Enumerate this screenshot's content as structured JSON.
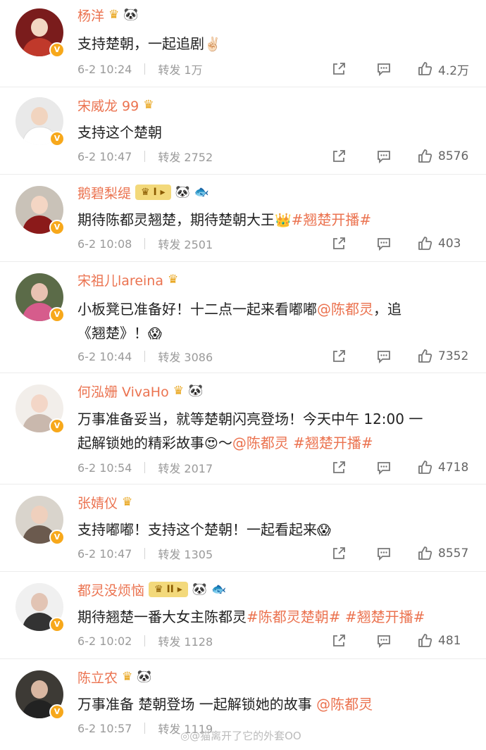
{
  "comments": [
    {
      "name": "杨洋",
      "badges": [
        "crown-icon",
        "panda-icon"
      ],
      "text": "支持楚朝，一起追剧",
      "emoji": "✌🏻",
      "date": "6-2 10:24",
      "repost": "转发 1万",
      "likes": "4.2万",
      "avatar_colors": [
        "#7a1c1c",
        "#f2d7c2",
        "#c0392b"
      ]
    },
    {
      "name": "宋威龙 99",
      "badges": [
        "crown-icon"
      ],
      "text": "支持这个楚朝",
      "date": "6-2 10:47",
      "repost": "转发 2752",
      "likes": "8576",
      "avatar_colors": [
        "#e9e9e9",
        "#f1d4bf",
        "#ffffff"
      ]
    },
    {
      "name": "鹅碧梨缇",
      "badges": [
        "crown-level-icon",
        "panda-icon",
        "fish-icon"
      ],
      "level": "I",
      "text": "期待陈都灵翘楚，期待楚朝大王",
      "emoji": "👑",
      "tag": "#翘楚开播#",
      "date": "6-2 10:08",
      "repost": "转发 2501",
      "likes": "403",
      "avatar_colors": [
        "#c9c2b8",
        "#f4d6c4",
        "#8b1a1a"
      ]
    },
    {
      "name": "宋祖儿lareina",
      "badges": [
        "crown-icon"
      ],
      "text_a": "小板凳已准备好！十二点一起来看嘟嘟",
      "mention": "@陈都灵",
      "text_b": "，追",
      "text_c": "《翘楚》！",
      "emoji": "😱",
      "date": "6-2 10:44",
      "repost": "转发 3086",
      "likes": "7352",
      "avatar_colors": [
        "#5b6b48",
        "#e8c2b2",
        "#d65c8c"
      ]
    },
    {
      "name": "何泓姗 VivaHo",
      "badges": [
        "crown-icon",
        "panda-icon"
      ],
      "text_a": "万事准备妥当，就等楚朝闪亮登场！今天中午 12:00 一",
      "text_b": "起解锁她的精彩故事",
      "emoji": "😍",
      "text_c": "～",
      "mention": "@陈都灵",
      "tag": "#翘楚开播#",
      "date": "6-2 10:54",
      "repost": "转发 2017",
      "likes": "4718",
      "avatar_colors": [
        "#f2eeea",
        "#f3d6c7",
        "#c9b8ad"
      ]
    },
    {
      "name": "张婧仪",
      "badges": [
        "crown-icon"
      ],
      "text": "支持嘟嘟！支持这个楚朝！一起看起来",
      "emoji": "😱",
      "date": "6-2 10:47",
      "repost": "转发 1305",
      "likes": "8557",
      "avatar_colors": [
        "#d9d4cc",
        "#efd0bd",
        "#6b5a4e"
      ]
    },
    {
      "name": "都灵没烦恼",
      "badges": [
        "crown-level-icon",
        "panda-icon",
        "fish-icon"
      ],
      "level": "II",
      "text": "期待翘楚一番大女主陈都灵",
      "tag": "#陈都灵楚朝#",
      "tag2": "#翘楚开播#",
      "date": "6-2 10:02",
      "repost": "转发 1128",
      "likes": "481",
      "avatar_colors": [
        "#f0f0f0",
        "#e2c4b4",
        "#333333"
      ]
    },
    {
      "name": "陈立农",
      "badges": [
        "crown-icon",
        "panda-icon"
      ],
      "text": "万事准备 楚朝登场 一起解锁她的故事",
      "mention": "@陈都灵",
      "date": "6-2 10:57",
      "repost": "转发 1119",
      "likes": "",
      "avatar_colors": [
        "#3d3a35",
        "#d9b7a2",
        "#222222"
      ]
    }
  ],
  "watermark": "@猫离开了它的外套OO",
  "watermark_icon": "weibo-logo-icon"
}
